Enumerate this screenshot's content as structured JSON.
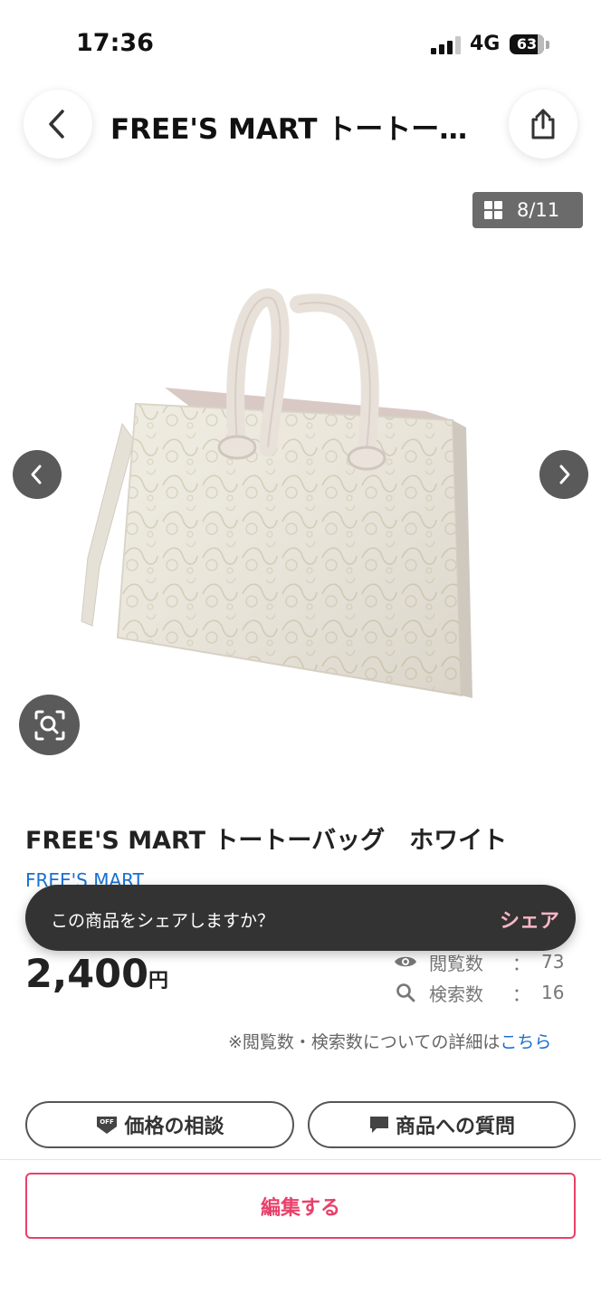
{
  "status_bar": {
    "time": "17:36",
    "network": "4G",
    "battery": "63"
  },
  "header": {
    "title": "FREE'S MART トートー…",
    "back_icon": "chevron-left-icon",
    "share_icon": "share-icon"
  },
  "gallery": {
    "counter": "8/11",
    "counter_icon": "grid-icon",
    "prev_icon": "chevron-left-icon",
    "next_icon": "chevron-right-icon",
    "lens_icon": "image-search-icon",
    "image_alt": "white lace tote bag"
  },
  "product": {
    "title": "FREE'S MART トートーバッグ　ホワイト",
    "brand": "FREE'S MART",
    "price": "2,400",
    "currency": "円"
  },
  "toast": {
    "message": "この商品をシェアしますか？",
    "action": "シェア"
  },
  "stats": {
    "views_label": "閲覧数",
    "views_value": "73",
    "searches_label": "検索数",
    "searches_value": "16",
    "colon": "："
  },
  "note": {
    "text": "※閲覧数・検索数についての詳細は",
    "link": "こちら"
  },
  "actions": {
    "negotiate_label": "価格の相談",
    "question_label": "商品への質問",
    "edit_label": "編集する"
  },
  "colors": {
    "accent": "#e8406a",
    "link": "#1a70d0",
    "toast_bg": "#333333",
    "toast_action": "#f8b7c7"
  }
}
